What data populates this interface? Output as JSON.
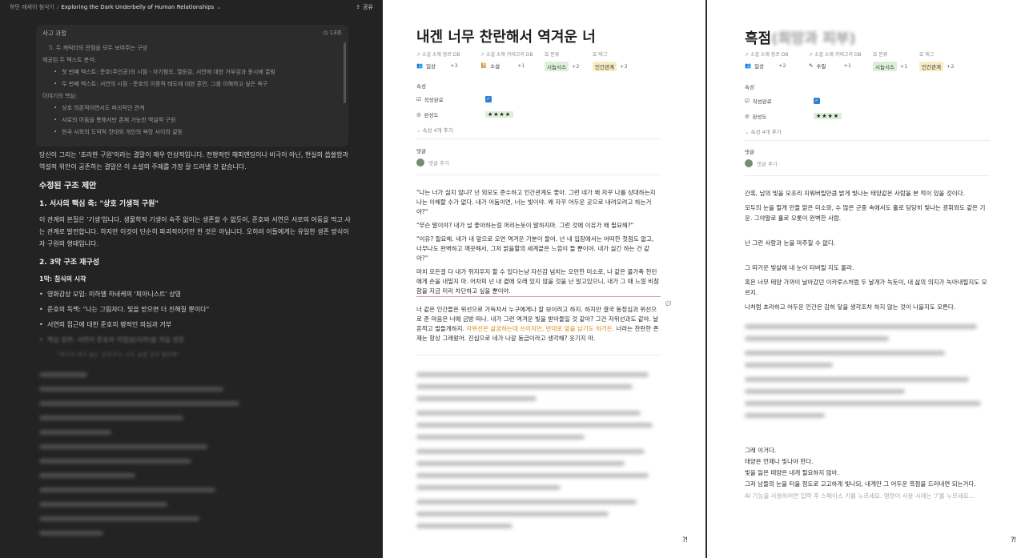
{
  "topbar": {
    "crumb1": "하민 에세이 첨삭기",
    "separator": "/",
    "crumb2": "Exploring the Dark Underbelly of Human Relationships",
    "share_label": "공유"
  },
  "thinking": {
    "header": "사고 과정",
    "count": "13초",
    "lines": [
      "5. 두 캐릭터의 관점을 모두 보여주는 구성",
      "제공된 두 텍스트 분석:",
      "첫 번째 텍스트: 준호(주인공)의 시점 - 자기혐오, 열등감, 서연에 대한 거부감과 동시에 끌림",
      "두 번째 텍스트: 서연의 시점 - 준호의 이중적 태도에 대한 혼란, 그를 이해하고 싶은 욕구",
      "이야기의 핵심:",
      "상호 의존적이면서도 파괴적인 관계",
      "서로의 어둠을 통해서만 존재 가능한 역설적 구원",
      "한국 사회의 도덕적 잣대와 개인의 욕망 사이의 갈등"
    ]
  },
  "answer": {
    "intro": "당신이 그리는 '초라한 구원'이라는 결말이 매우 인상적입니다. 전형적인 해피엔딩이나 비극이 아닌, 현실의 씁쓸함과 역설적 위안이 공존하는 결말은 이 소설의 주제를 가장 잘 드러낼 것 같습니다.",
    "h_structure": "수정된 구조 제안",
    "h_core": "1. 서사의 핵심 축: \"상호 기생적 구원\"",
    "core_text": "이 관계의 본질은 '기생'입니다. 생물학적 기생이 숙주 없이는 생존할 수 없듯이, 준호와 서연은 서로의 어둠을 먹고 사는 관계로 발전합니다. 하지만 이것이 단순히 파괴적이기만 한 것은 아닙니다. 오히려 이들에게는 유일한 생존 방식이자 구원의 형태입니다.",
    "h_three": "2. 3막 구조 재구성",
    "act1": "1막: 침식의 시작",
    "act1_items": [
      "영화감상 모임: 미하엘 하네케의 '피아니스트' 상영",
      "준호의 독백: \"나는 그림자다. 빛을 받으면 더 진해질 뿐이다\"",
      "서연의 접근에 대한 준호의 병적인 의심과 거부",
      "핵심 장면: 서연이 준호의 작업실(지하)을 처음 방문"
    ],
    "act1_sub": "\"여기가 네가 숨는 곳이구나. 나도 숨을 곳이 필요해\""
  },
  "doc_left": {
    "title": "내겐 너무 찬란해서 역겨운 너",
    "prop_genre_label": "소설 소재 장르 DB",
    "prop_genre_value": "일상",
    "prop_genre_plus": "+3",
    "prop_category_label": "소설 소재 카테고리 DB",
    "prop_category_value": "소설",
    "prop_category_plus": "+1",
    "prop_class_label": "분류",
    "prop_class_value": "시놉시스",
    "prop_class_plus": "+2",
    "prop_tag_label": "태그",
    "prop_tag_value": "인간관계",
    "prop_tag_plus": "+3",
    "section_props": "속성",
    "complete_label": "작성완료",
    "rating_label": "완성도",
    "rating_stars": "★★★★",
    "more_props": "속성 4개 추가",
    "comments_label": "댓글",
    "add_comment": "댓글 추가",
    "paragraphs": [
      "\"나는 너가 싫지 않냐? 넌 외모도 준수하고 인간관계도 좋아. 그런 네가 왜 자꾸 나를 상대하는지 나는 이해할 수가 없다. 내가 어둠이면, 너는 빛이야. 왜 자꾸 어두운 곳으로 내려오려고 하는거야?\"",
      "\"무슨 말이야? 내가 널 좋아하는걸 꺼리는듯이 말하지마. 그런 것에 이유가 왜 필요해?\"",
      "\"이유? 필요해. 네가 내 앞으로 오면 역겨운 기분이 들어. 넌 내 입장에서는 어떠한 첫점도 없고, 너무나도 완벽하고 깨끗해서, 그저 밝을할의 세계끝은 느낌이 들 뿐이야. 내가 싫긴 하는 건 같아?\"",
      "마치 모든걸 다 내가 쥐지우지 할 수 있다는냥 자신감 넘치는 오만한 미소로, 나 같은 불가촉 천민에게 손을 내밀지 마. 어차피 넌 내 곁에 오래 있지 않을 것을 난 알고있으니, 내가 그 때 느낄 비참함을 지금 미리 차단하고 싶을 뿐이야.",
      "너 같은 인간들은 위선으로 가득차서 누구에게나 잘 보이려고 하지. 하지만 결국 동정심과 위선으로 준 마음은 너에 금방 떠나. 내가 그런 역겨운 빛을 받아들일 것 같아? 그건 자위선과도 같아. 날 흔적고 벌들게하지.",
      "자위선은 삶궁하는데 쓰이지만, 반대로 앞을 남기도 하거든.",
      "너라는 찬란한 존재는 항상 그래왔어. 진심으로 네가 나갈 동급이라고 생각해? 웃기지 마."
    ]
  },
  "doc_right": {
    "title": "흑점",
    "title_suffix": "(희망과 피부)",
    "prop_genre_label": "소설 소재 장르 DB",
    "prop_genre_value": "일상",
    "prop_genre_plus": "+2",
    "prop_category_label": "소설 소재 카테고리 DB",
    "prop_category_value": "수필",
    "prop_category_plus": "+1",
    "prop_class_label": "분류",
    "prop_class_value": "시놉시스",
    "prop_class_plus": "+1",
    "prop_tag_label": "태그",
    "prop_tag_value": "인간관계",
    "prop_tag_plus": "+2",
    "section_props": "속성",
    "complete_label": "작성완료",
    "rating_label": "완성도",
    "rating_stars": "★★★★",
    "more_props": "속성 4개 추가",
    "comments_label": "댓글",
    "add_comment": "댓글 추가",
    "p1": "간혹, 남의 빛을 모조리 지워버릴만큼 밝게 빛나는 태양같은 사람을 본 적이 있을 것이다.",
    "p2": "모두의 눈을 멀게 만들 맑은 미소와, 수 많은 군중 속에서도 홀로 당당히 빛나는 광휘와도 같은 기운. 그야말로 홀로 오롯이 완벽한 사람.",
    "p3": "난 그런 사람과 눈을 마주칠 수 없다.",
    "p4": "그 따가운 빛살에 내 눈이 타버릴 지도 몰라.",
    "p5": "혹은 너무 태양 가까이 날아갔던 이카루스처럼 두 날개가 녹듯이, 내 삶의 의지가 녹아내릴지도 모르지.",
    "p6": "나처럼 초라하고 어두운 인간은 감히 닿을 생각조차 하지 않는 것이 나을지도 모른다.",
    "p7": "그래 이거다.",
    "p8": "태양은 언제나 빛나야 한다.",
    "p9": "빛을 잃은 태양은 내게 필요하지 않아.",
    "p10": "그저 남들의 눈을 터울 정도로 고고하게 빛나되, 내게만 그 어두운 흑점을 드러내면 되는거다.",
    "ai_hint": "AI 기능을 사용하려면 입력 후 스페이스 키를 누르세요. 명령어 사용 시에는 '/'를 누르세요..."
  }
}
